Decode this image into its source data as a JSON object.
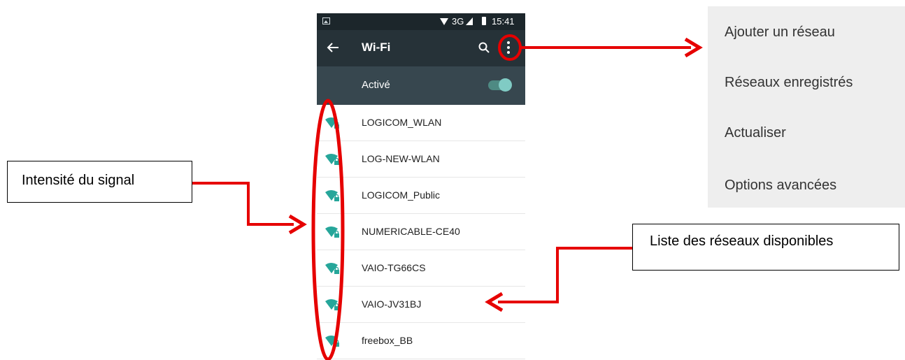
{
  "status_bar": {
    "network_type": "3G",
    "time": "15:41"
  },
  "toolbar": {
    "title": "Wi-Fi"
  },
  "wifi_switch": {
    "label": "Activé",
    "enabled": true
  },
  "networks": [
    {
      "ssid": "LOGICOM_WLAN"
    },
    {
      "ssid": "LOG-NEW-WLAN"
    },
    {
      "ssid": "LOGICOM_Public"
    },
    {
      "ssid": "NUMERICABLE-CE40"
    },
    {
      "ssid": "VAIO-TG66CS"
    },
    {
      "ssid": "VAIO-JV31BJ"
    },
    {
      "ssid": "freebox_BB"
    }
  ],
  "overflow_menu": {
    "items": [
      {
        "label": "Ajouter un réseau"
      },
      {
        "label": "Réseaux enregistrés"
      },
      {
        "label": "Actualiser"
      },
      {
        "label": "Options avancées"
      }
    ]
  },
  "annotations": {
    "signal_label": "Intensité du signal",
    "list_label": "Liste des réseaux disponibles"
  },
  "colors": {
    "annotation_red": "#e60000",
    "accent_teal": "#26a69a",
    "toolbar": "#263238",
    "switch_bar": "#37474f"
  }
}
